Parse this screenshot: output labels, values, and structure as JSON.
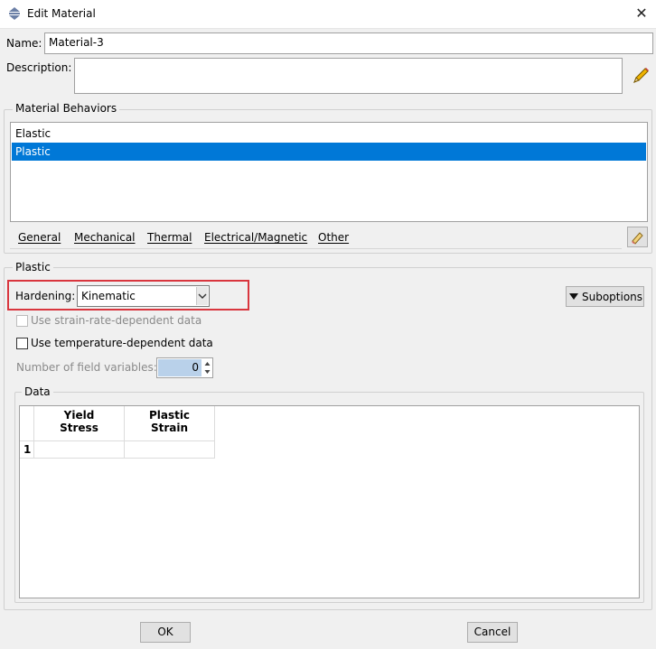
{
  "window": {
    "title": "Edit Material",
    "close_label": "✕",
    "app_icon": "material-app-icon"
  },
  "name": {
    "label": "Name:",
    "value": "Material-3"
  },
  "description": {
    "label": "Description:",
    "value": "",
    "edit_icon": "pencil-icon"
  },
  "behaviors": {
    "title": "Material Behaviors",
    "items": [
      {
        "label": "Elastic",
        "selected": false
      },
      {
        "label": "Plastic",
        "selected": true
      }
    ]
  },
  "menu": {
    "items": [
      "General",
      "Mechanical",
      "Thermal",
      "Electrical/Magnetic",
      "Other"
    ],
    "edit_icon": "eraser-icon"
  },
  "plastic": {
    "title": "Plastic",
    "hardening_label": "Hardening:",
    "hardening_value": "Kinematic",
    "suboptions_label": "Suboptions",
    "strain_rate_label": "Use strain-rate-dependent data",
    "strain_rate_checked": false,
    "strain_rate_enabled": false,
    "temperature_label": "Use temperature-dependent data",
    "temperature_checked": false,
    "field_vars_label": "Number of field variables:",
    "field_vars_value": "0"
  },
  "data": {
    "title": "Data",
    "columns": [
      {
        "line1": "Yield",
        "line2": "Stress"
      },
      {
        "line1": "Plastic",
        "line2": "Strain"
      }
    ],
    "rows": [
      {
        "index": "1",
        "values": [
          "",
          ""
        ]
      }
    ]
  },
  "buttons": {
    "ok": "OK",
    "cancel": "Cancel"
  },
  "colors": {
    "selection": "#0078d7",
    "highlight_box": "#d9363e",
    "spin_bg": "#b9d1ea"
  }
}
